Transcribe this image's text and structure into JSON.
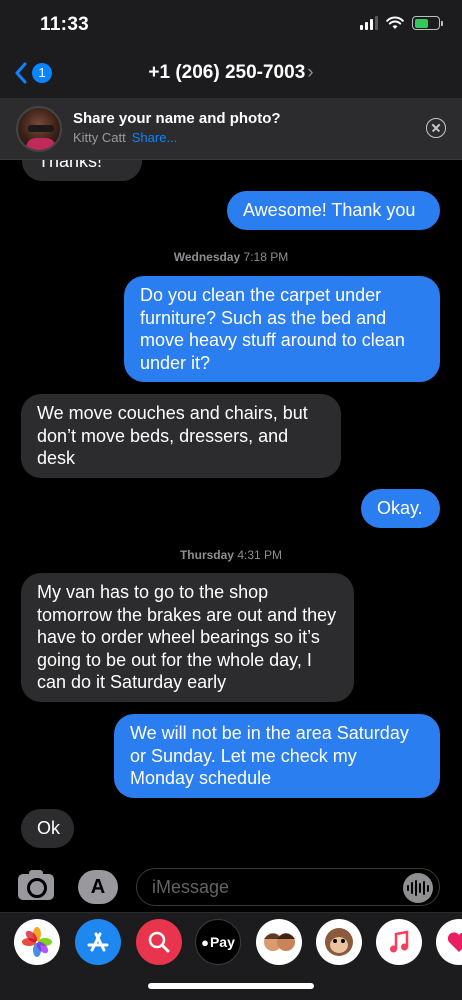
{
  "status_bar": {
    "time": "11:33"
  },
  "nav": {
    "unread_count": "1",
    "contact": "+1 (206) 250-7003",
    "chevron": "›"
  },
  "share_banner": {
    "title": "Share your name and photo?",
    "name": "Kitty  Catt",
    "action": "Share..."
  },
  "messages": [
    {
      "direction": "in",
      "text": "Thanks!"
    },
    {
      "direction": "out",
      "text": "Awesome! Thank you"
    },
    {
      "type": "timestamp",
      "day": "Wednesday",
      "time": "7:18 PM"
    },
    {
      "direction": "out",
      "text": "Do you clean the carpet under furniture? Such as the bed and move heavy stuff around to clean under it?"
    },
    {
      "direction": "in",
      "text": "We move couches and chairs, but don’t move beds,  dressers, and desk"
    },
    {
      "direction": "out",
      "text": "Okay."
    },
    {
      "type": "timestamp",
      "day": "Thursday",
      "time": "4:31 PM"
    },
    {
      "direction": "in",
      "text": "My van has to go to the shop tomorrow the brakes are out and they have to order wheel bearings so it’s going to be out for the whole day, I can do it Saturday early"
    },
    {
      "direction": "out",
      "text": "We will not be in the area Saturday or Sunday.  Let me check my Monday schedule"
    },
    {
      "direction": "in",
      "text": "Ok"
    }
  ],
  "compose": {
    "placeholder": "iMessage",
    "apps_glyph": "A"
  },
  "drawer": {
    "apple_pay_label": "Pay",
    "apps": [
      "photos-icon",
      "app-store-icon",
      "web-search-icon",
      "apple-pay-icon",
      "memoji-icon",
      "animoji-icon",
      "music-icon",
      "heart-sticker-icon"
    ]
  },
  "colors": {
    "outgoing_bubble": "#2b7ef0",
    "incoming_bubble": "#2c2c2e",
    "accent": "#0a84ff",
    "battery": "#34c759"
  }
}
